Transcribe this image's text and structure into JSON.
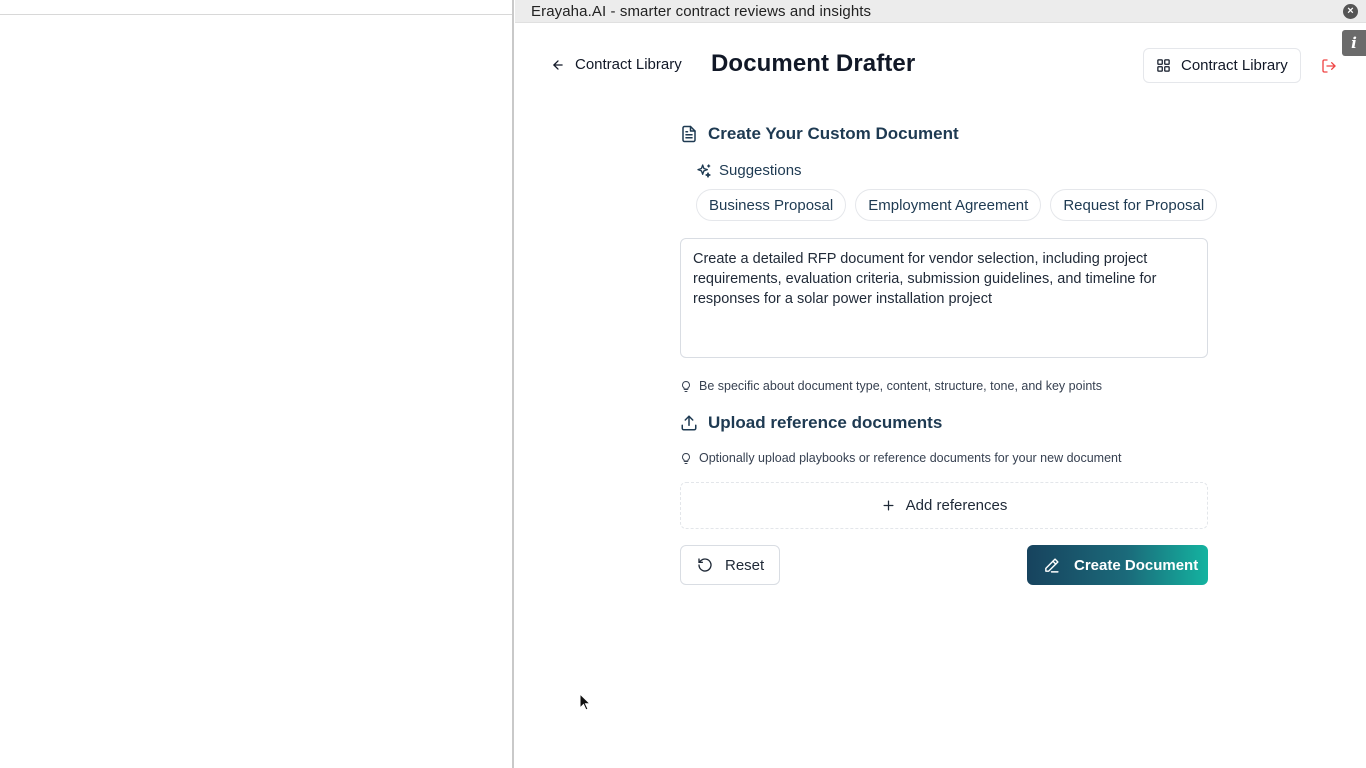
{
  "window": {
    "title": "Erayaha.AI - smarter contract reviews and insights",
    "close_glyph": "×",
    "info_glyph": "i"
  },
  "header": {
    "back_label": "Contract Library",
    "page_title": "Document Drafter",
    "library_button_label": "Contract Library",
    "accent_logout_color": "#ef4444"
  },
  "custom_document": {
    "heading": "Create Your Custom Document",
    "suggestions_label": "Suggestions",
    "suggestions": [
      "Business Proposal",
      "Employment Agreement",
      "Request for Proposal"
    ],
    "prompt_value": "Create a detailed RFP document for vendor selection, including project requirements, evaluation criteria, submission guidelines, and timeline for responses for a solar power installation project",
    "hint": "Be specific about document type, content, structure, tone, and key points"
  },
  "upload": {
    "heading": "Upload reference documents",
    "hint": "Optionally upload playbooks or reference documents for your new document",
    "add_label": "Add references"
  },
  "actions": {
    "reset_label": "Reset",
    "create_label": "Create Document"
  },
  "colors": {
    "brand_dark": "#17435e",
    "brand_teal": "#14b3a0",
    "heading": "#1e3a52"
  },
  "icons": {
    "back": "arrow-left-icon",
    "library": "grid-icon",
    "logout": "logout-icon",
    "document": "document-icon",
    "sparkle": "sparkles-icon",
    "bulb": "lightbulb-icon",
    "upload": "upload-icon",
    "plus": "plus-icon",
    "reset": "rotate-ccw-icon",
    "pen": "pen-icon"
  }
}
